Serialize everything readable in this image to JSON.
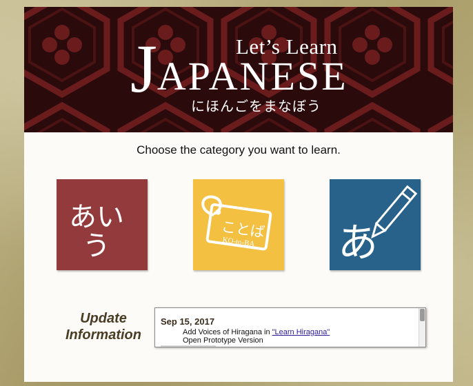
{
  "banner": {
    "lets_learn": "Let’s Learn",
    "title_initial": "J",
    "title_rest": "APANESE",
    "subtitle_kana": "にほんごをまなぼう"
  },
  "prompt": "Choose the category you want to learn.",
  "tiles": [
    {
      "label_line1": "あい",
      "label_line2": "う",
      "color": "#923a3c"
    },
    {
      "label_kana": "ことば",
      "label_romaji": "KO-to-BA",
      "color": "#f4c042"
    },
    {
      "label_kana": "あ",
      "color": "#28628a",
      "icon": "pencil-icon"
    }
  ],
  "update": {
    "heading_line1": "Update",
    "heading_line2": "Information",
    "entries": [
      {
        "date": "Sep 15, 2017",
        "line1_prefix": "Add Voices of Hiragana in ",
        "line1_link": "\"Learn Hiragana\"",
        "line2": "Open Prototype Version"
      }
    ]
  },
  "colors": {
    "banner_background": "#2a0a0b",
    "banner_pattern": "#6a1c1d",
    "frame": "#b9ad7e",
    "heading_text": "#4a3c24"
  }
}
